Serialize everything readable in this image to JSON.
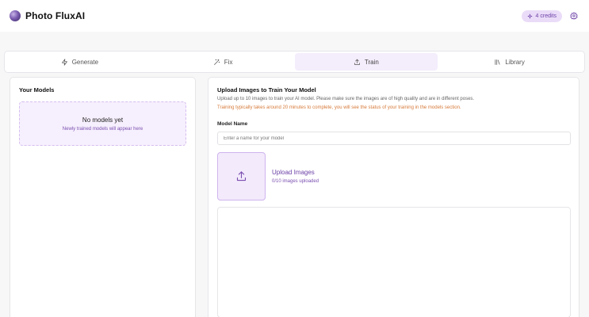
{
  "header": {
    "brand": "Photo FluxAI",
    "credits": "4 credits",
    "icons": {
      "logo": "logo-icon",
      "credits": "sparkle-icon",
      "settings": "gear-icon"
    }
  },
  "tabs": [
    {
      "label": "Generate",
      "icon": "lightning-icon",
      "active": false
    },
    {
      "label": "Fix",
      "icon": "magic-wand-icon",
      "active": false
    },
    {
      "label": "Train",
      "icon": "upload-icon",
      "active": true
    },
    {
      "label": "Library",
      "icon": "library-icon",
      "active": false
    }
  ],
  "models": {
    "title": "Your Models",
    "empty_title": "No models yet",
    "empty_subtitle": "Newly trained models will appear here"
  },
  "upload": {
    "title": "Upload Images to Train Your Model",
    "description": "Upload up to 10 images to train your AI model. Please make sure the images are of high quality and are in different poses.",
    "note": "Training typically takes around 20 minutes to complete, you will see the status of your training in the models section.",
    "model_name_label": "Model Name",
    "model_name_placeholder": "Enter a name for your model",
    "model_name_value": "",
    "upload_title": "Upload Images",
    "upload_count": "0/10 images uploaded"
  },
  "colors": {
    "accent": "#7a4fb0",
    "accent_light": "#f4edfc",
    "note": "#d77a3a",
    "background": "#f7f7f8"
  }
}
